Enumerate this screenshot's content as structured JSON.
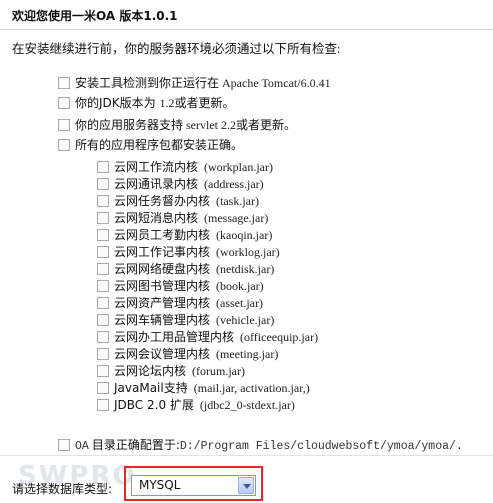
{
  "header": {
    "title": "欢迎您使用一米OA 版本1.0.1"
  },
  "intro": "在安装继续进行前，你的服务器环境必须通过以下所有检查:",
  "checks": [
    {
      "zh": "安装工具检测到你正运行在",
      "suffix": " Apache Tomcat/6.0.41"
    },
    {
      "zh": "你的JDK版本为 ",
      "suffix": "1.2",
      "after": "或者更新。"
    },
    {
      "zh": "你的应用服务器支持",
      "suffix": " servlet 2.2",
      "after": "或者更新。"
    },
    {
      "zh": "所有的应用程序包都安装正确。",
      "suffix": ""
    }
  ],
  "packages": [
    {
      "name": "云网工作流内核",
      "file": "(workplan.jar)"
    },
    {
      "name": "云网通讯录内核",
      "file": "(address.jar)"
    },
    {
      "name": "云网任务督办内核",
      "file": "(task.jar)"
    },
    {
      "name": "云网短消息内核",
      "file": "(message.jar)"
    },
    {
      "name": "云网员工考勤内核",
      "file": "(kaoqin.jar)"
    },
    {
      "name": "云网工作记事内核",
      "file": "(worklog.jar)"
    },
    {
      "name": "云网网络硬盘内核",
      "file": "(netdisk.jar)"
    },
    {
      "name": "云网图书管理内核",
      "file": "(book.jar)"
    },
    {
      "name": "云网资产管理内核",
      "file": "(asset.jar)"
    },
    {
      "name": "云网车辆管理内核",
      "file": "(vehicle.jar)"
    },
    {
      "name": "云网办工用品管理内核",
      "file": "(officeequip.jar)"
    },
    {
      "name": "云网会议管理内核",
      "file": "(meeting.jar)"
    },
    {
      "name": "云网论坛内核",
      "file": "(forum.jar)"
    },
    {
      "name": "JavaMail支持",
      "file": "(mail.jar, activation.jar,)"
    },
    {
      "name": "JDBC 2.0 扩展",
      "file": "(jdbc2_0-stdext.jar)"
    }
  ],
  "config": {
    "prefix": "OA",
    "label": "目录正确配置于:",
    "path": "D:/Program Files/cloudwebsoft/ymoa/ymoa/."
  },
  "watermark": "SWPRO",
  "db": {
    "label": "请选择数据库类型:",
    "selected": "MYSQL"
  }
}
